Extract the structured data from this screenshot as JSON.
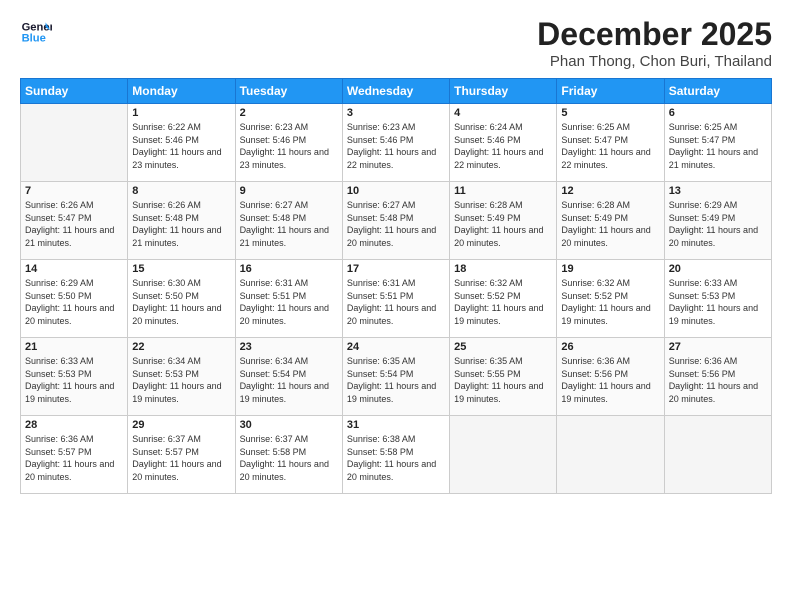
{
  "logo": {
    "line1": "General",
    "line2": "Blue"
  },
  "title": "December 2025",
  "subtitle": "Phan Thong, Chon Buri, Thailand",
  "days_of_week": [
    "Sunday",
    "Monday",
    "Tuesday",
    "Wednesday",
    "Thursday",
    "Friday",
    "Saturday"
  ],
  "weeks": [
    [
      {
        "day": "",
        "sunrise": "",
        "sunset": "",
        "daylight": ""
      },
      {
        "day": "1",
        "sunrise": "Sunrise: 6:22 AM",
        "sunset": "Sunset: 5:46 PM",
        "daylight": "Daylight: 11 hours and 23 minutes."
      },
      {
        "day": "2",
        "sunrise": "Sunrise: 6:23 AM",
        "sunset": "Sunset: 5:46 PM",
        "daylight": "Daylight: 11 hours and 23 minutes."
      },
      {
        "day": "3",
        "sunrise": "Sunrise: 6:23 AM",
        "sunset": "Sunset: 5:46 PM",
        "daylight": "Daylight: 11 hours and 22 minutes."
      },
      {
        "day": "4",
        "sunrise": "Sunrise: 6:24 AM",
        "sunset": "Sunset: 5:46 PM",
        "daylight": "Daylight: 11 hours and 22 minutes."
      },
      {
        "day": "5",
        "sunrise": "Sunrise: 6:25 AM",
        "sunset": "Sunset: 5:47 PM",
        "daylight": "Daylight: 11 hours and 22 minutes."
      },
      {
        "day": "6",
        "sunrise": "Sunrise: 6:25 AM",
        "sunset": "Sunset: 5:47 PM",
        "daylight": "Daylight: 11 hours and 21 minutes."
      }
    ],
    [
      {
        "day": "7",
        "sunrise": "Sunrise: 6:26 AM",
        "sunset": "Sunset: 5:47 PM",
        "daylight": "Daylight: 11 hours and 21 minutes."
      },
      {
        "day": "8",
        "sunrise": "Sunrise: 6:26 AM",
        "sunset": "Sunset: 5:48 PM",
        "daylight": "Daylight: 11 hours and 21 minutes."
      },
      {
        "day": "9",
        "sunrise": "Sunrise: 6:27 AM",
        "sunset": "Sunset: 5:48 PM",
        "daylight": "Daylight: 11 hours and 21 minutes."
      },
      {
        "day": "10",
        "sunrise": "Sunrise: 6:27 AM",
        "sunset": "Sunset: 5:48 PM",
        "daylight": "Daylight: 11 hours and 20 minutes."
      },
      {
        "day": "11",
        "sunrise": "Sunrise: 6:28 AM",
        "sunset": "Sunset: 5:49 PM",
        "daylight": "Daylight: 11 hours and 20 minutes."
      },
      {
        "day": "12",
        "sunrise": "Sunrise: 6:28 AM",
        "sunset": "Sunset: 5:49 PM",
        "daylight": "Daylight: 11 hours and 20 minutes."
      },
      {
        "day": "13",
        "sunrise": "Sunrise: 6:29 AM",
        "sunset": "Sunset: 5:49 PM",
        "daylight": "Daylight: 11 hours and 20 minutes."
      }
    ],
    [
      {
        "day": "14",
        "sunrise": "Sunrise: 6:29 AM",
        "sunset": "Sunset: 5:50 PM",
        "daylight": "Daylight: 11 hours and 20 minutes."
      },
      {
        "day": "15",
        "sunrise": "Sunrise: 6:30 AM",
        "sunset": "Sunset: 5:50 PM",
        "daylight": "Daylight: 11 hours and 20 minutes."
      },
      {
        "day": "16",
        "sunrise": "Sunrise: 6:31 AM",
        "sunset": "Sunset: 5:51 PM",
        "daylight": "Daylight: 11 hours and 20 minutes."
      },
      {
        "day": "17",
        "sunrise": "Sunrise: 6:31 AM",
        "sunset": "Sunset: 5:51 PM",
        "daylight": "Daylight: 11 hours and 20 minutes."
      },
      {
        "day": "18",
        "sunrise": "Sunrise: 6:32 AM",
        "sunset": "Sunset: 5:52 PM",
        "daylight": "Daylight: 11 hours and 19 minutes."
      },
      {
        "day": "19",
        "sunrise": "Sunrise: 6:32 AM",
        "sunset": "Sunset: 5:52 PM",
        "daylight": "Daylight: 11 hours and 19 minutes."
      },
      {
        "day": "20",
        "sunrise": "Sunrise: 6:33 AM",
        "sunset": "Sunset: 5:53 PM",
        "daylight": "Daylight: 11 hours and 19 minutes."
      }
    ],
    [
      {
        "day": "21",
        "sunrise": "Sunrise: 6:33 AM",
        "sunset": "Sunset: 5:53 PM",
        "daylight": "Daylight: 11 hours and 19 minutes."
      },
      {
        "day": "22",
        "sunrise": "Sunrise: 6:34 AM",
        "sunset": "Sunset: 5:53 PM",
        "daylight": "Daylight: 11 hours and 19 minutes."
      },
      {
        "day": "23",
        "sunrise": "Sunrise: 6:34 AM",
        "sunset": "Sunset: 5:54 PM",
        "daylight": "Daylight: 11 hours and 19 minutes."
      },
      {
        "day": "24",
        "sunrise": "Sunrise: 6:35 AM",
        "sunset": "Sunset: 5:54 PM",
        "daylight": "Daylight: 11 hours and 19 minutes."
      },
      {
        "day": "25",
        "sunrise": "Sunrise: 6:35 AM",
        "sunset": "Sunset: 5:55 PM",
        "daylight": "Daylight: 11 hours and 19 minutes."
      },
      {
        "day": "26",
        "sunrise": "Sunrise: 6:36 AM",
        "sunset": "Sunset: 5:56 PM",
        "daylight": "Daylight: 11 hours and 19 minutes."
      },
      {
        "day": "27",
        "sunrise": "Sunrise: 6:36 AM",
        "sunset": "Sunset: 5:56 PM",
        "daylight": "Daylight: 11 hours and 20 minutes."
      }
    ],
    [
      {
        "day": "28",
        "sunrise": "Sunrise: 6:36 AM",
        "sunset": "Sunset: 5:57 PM",
        "daylight": "Daylight: 11 hours and 20 minutes."
      },
      {
        "day": "29",
        "sunrise": "Sunrise: 6:37 AM",
        "sunset": "Sunset: 5:57 PM",
        "daylight": "Daylight: 11 hours and 20 minutes."
      },
      {
        "day": "30",
        "sunrise": "Sunrise: 6:37 AM",
        "sunset": "Sunset: 5:58 PM",
        "daylight": "Daylight: 11 hours and 20 minutes."
      },
      {
        "day": "31",
        "sunrise": "Sunrise: 6:38 AM",
        "sunset": "Sunset: 5:58 PM",
        "daylight": "Daylight: 11 hours and 20 minutes."
      },
      {
        "day": "",
        "sunrise": "",
        "sunset": "",
        "daylight": ""
      },
      {
        "day": "",
        "sunrise": "",
        "sunset": "",
        "daylight": ""
      },
      {
        "day": "",
        "sunrise": "",
        "sunset": "",
        "daylight": ""
      }
    ]
  ]
}
